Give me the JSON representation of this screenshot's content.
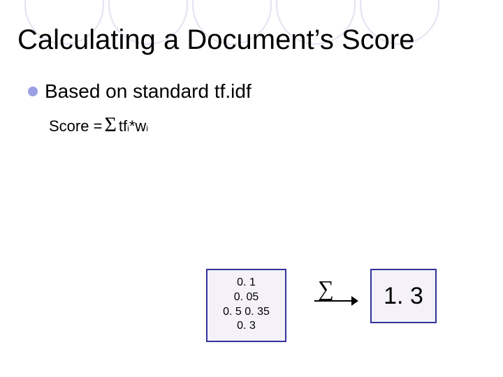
{
  "title": "Calculating a Document’s Score",
  "bullet": {
    "text": "Based on standard tf.idf"
  },
  "formula": {
    "prefix": "Score = ",
    "sigma": "Σ",
    "term_tf": "tf",
    "term_tf_sub": "i",
    "mult": " * ",
    "term_w": "w",
    "term_w_sub": "i"
  },
  "numbox": {
    "line1": "0. 1",
    "line2": "0. 05",
    "line3": "0. 5 0. 35",
    "line4": "0. 3"
  },
  "sum": {
    "sigma": "∑",
    "result": "1. 3"
  }
}
